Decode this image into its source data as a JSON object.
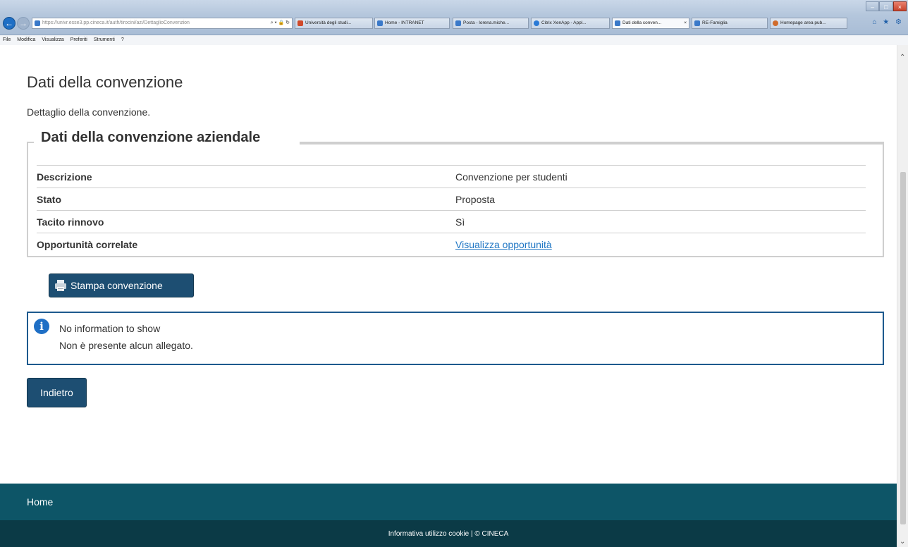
{
  "browser": {
    "address_url": "https://univr.esse3.pp.cineca.it/auth/tirocini/azi/DettaglioConvenzion",
    "address_controls": "⌕ ▾ 🔒 ↻",
    "tabs": [
      {
        "label": "Università degli studi...",
        "color": "#d04a2b"
      },
      {
        "label": "Home - INTRANET",
        "color": "#3a79c9"
      },
      {
        "label": "Posta - lorena.miche...",
        "color": "#3a79c9"
      },
      {
        "label": "Citrix XenApp - Appl...",
        "color": "#2a7ad6"
      },
      {
        "label": "Dati della conven...",
        "color": "#3a79c9",
        "close": "×"
      },
      {
        "label": "RE-Famiglia",
        "color": "#3a79c9"
      },
      {
        "label": "Homepage area pub...",
        "color": "#d06b2b"
      }
    ],
    "menu": [
      "File",
      "Modifica",
      "Visualizza",
      "Preferiti",
      "Strumenti",
      "?"
    ],
    "right_tools": "⌂ ★ ⚙"
  },
  "page": {
    "title": "Dati della convenzione",
    "description": "Dettaglio della convenzione.",
    "section_legend": "Dati della convenzione aziendale",
    "details": [
      {
        "key": "Descrizione",
        "value": "Convenzione per studenti"
      },
      {
        "key": "Stato",
        "value": "Proposta"
      },
      {
        "key": "Tacito rinnovo",
        "value": "Sì"
      },
      {
        "key": "Opportunità correlate",
        "link": "Visualizza opportunità"
      }
    ],
    "print_button": "Stampa convenzione",
    "info": {
      "line1": "No information to show",
      "line2": "Non è presente alcun allegato."
    },
    "back_button": "Indietro"
  },
  "footer": {
    "home": "Home",
    "bottom": "Informativa utilizzo cookie | © CINECA"
  }
}
